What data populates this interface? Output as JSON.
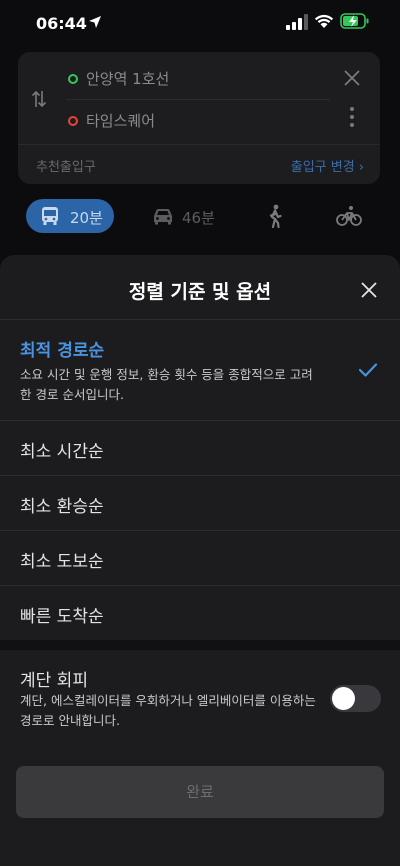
{
  "status_bar": {
    "time": "06:44"
  },
  "route": {
    "origin": "안양역 1호선",
    "destination": "타임스퀘어",
    "recommended_exit_label": "추천출입구",
    "exit_change_label": "출입구 변경 ›"
  },
  "modes": {
    "bus": "20분",
    "car": "46분"
  },
  "sheet": {
    "title": "정렬 기준 및 옵션",
    "options": [
      {
        "label": "최적 경로순",
        "description": "소요 시간 및 운행 정보, 환승 횟수 등을 종합적으로 고려한 경로 순서입니다.",
        "selected": true
      },
      {
        "label": "최소 시간순"
      },
      {
        "label": "최소 환승순"
      },
      {
        "label": "최소 도보순"
      },
      {
        "label": "빠른 도착순"
      }
    ],
    "stairs": {
      "title": "계단 회피",
      "description": "계단, 에스컬레이터를 우회하거나 엘리베이터를 이용하는 경로로 안내합니다.",
      "enabled": false
    },
    "done_label": "완료"
  },
  "colors": {
    "accent": "#4a93e0",
    "bus_tab": "#2c64a8",
    "origin_dot": "#35c759",
    "destination_dot": "#e5453b"
  }
}
